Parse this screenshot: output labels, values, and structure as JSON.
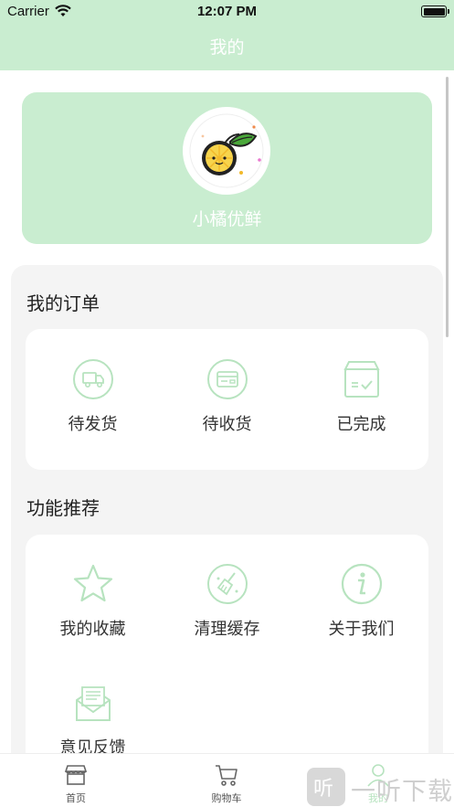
{
  "status_bar": {
    "carrier": "Carrier",
    "time": "12:07 PM"
  },
  "nav": {
    "title": "我的"
  },
  "profile": {
    "name": "小橘优鲜"
  },
  "orders": {
    "title": "我的订单",
    "items": [
      {
        "label": "待发货",
        "icon": "truck-icon"
      },
      {
        "label": "待收货",
        "icon": "card-icon"
      },
      {
        "label": "已完成",
        "icon": "box-check-icon"
      }
    ]
  },
  "features": {
    "title": "功能推荐",
    "items": [
      {
        "label": "我的收藏",
        "icon": "star-icon"
      },
      {
        "label": "清理缓存",
        "icon": "broom-icon"
      },
      {
        "label": "关于我们",
        "icon": "info-icon"
      },
      {
        "label": "意见反馈",
        "icon": "mail-icon"
      }
    ]
  },
  "tabbar": {
    "tabs": [
      {
        "label": "首页",
        "icon": "shop-icon"
      },
      {
        "label": "购物车",
        "icon": "cart-icon"
      },
      {
        "label": "我的",
        "icon": "user-icon",
        "active": true
      }
    ]
  },
  "watermark": {
    "text": "一听下载"
  },
  "colors": {
    "accent": "#c9edd0",
    "icon_green": "#b7e3bf",
    "panel": "#f4f4f4"
  }
}
